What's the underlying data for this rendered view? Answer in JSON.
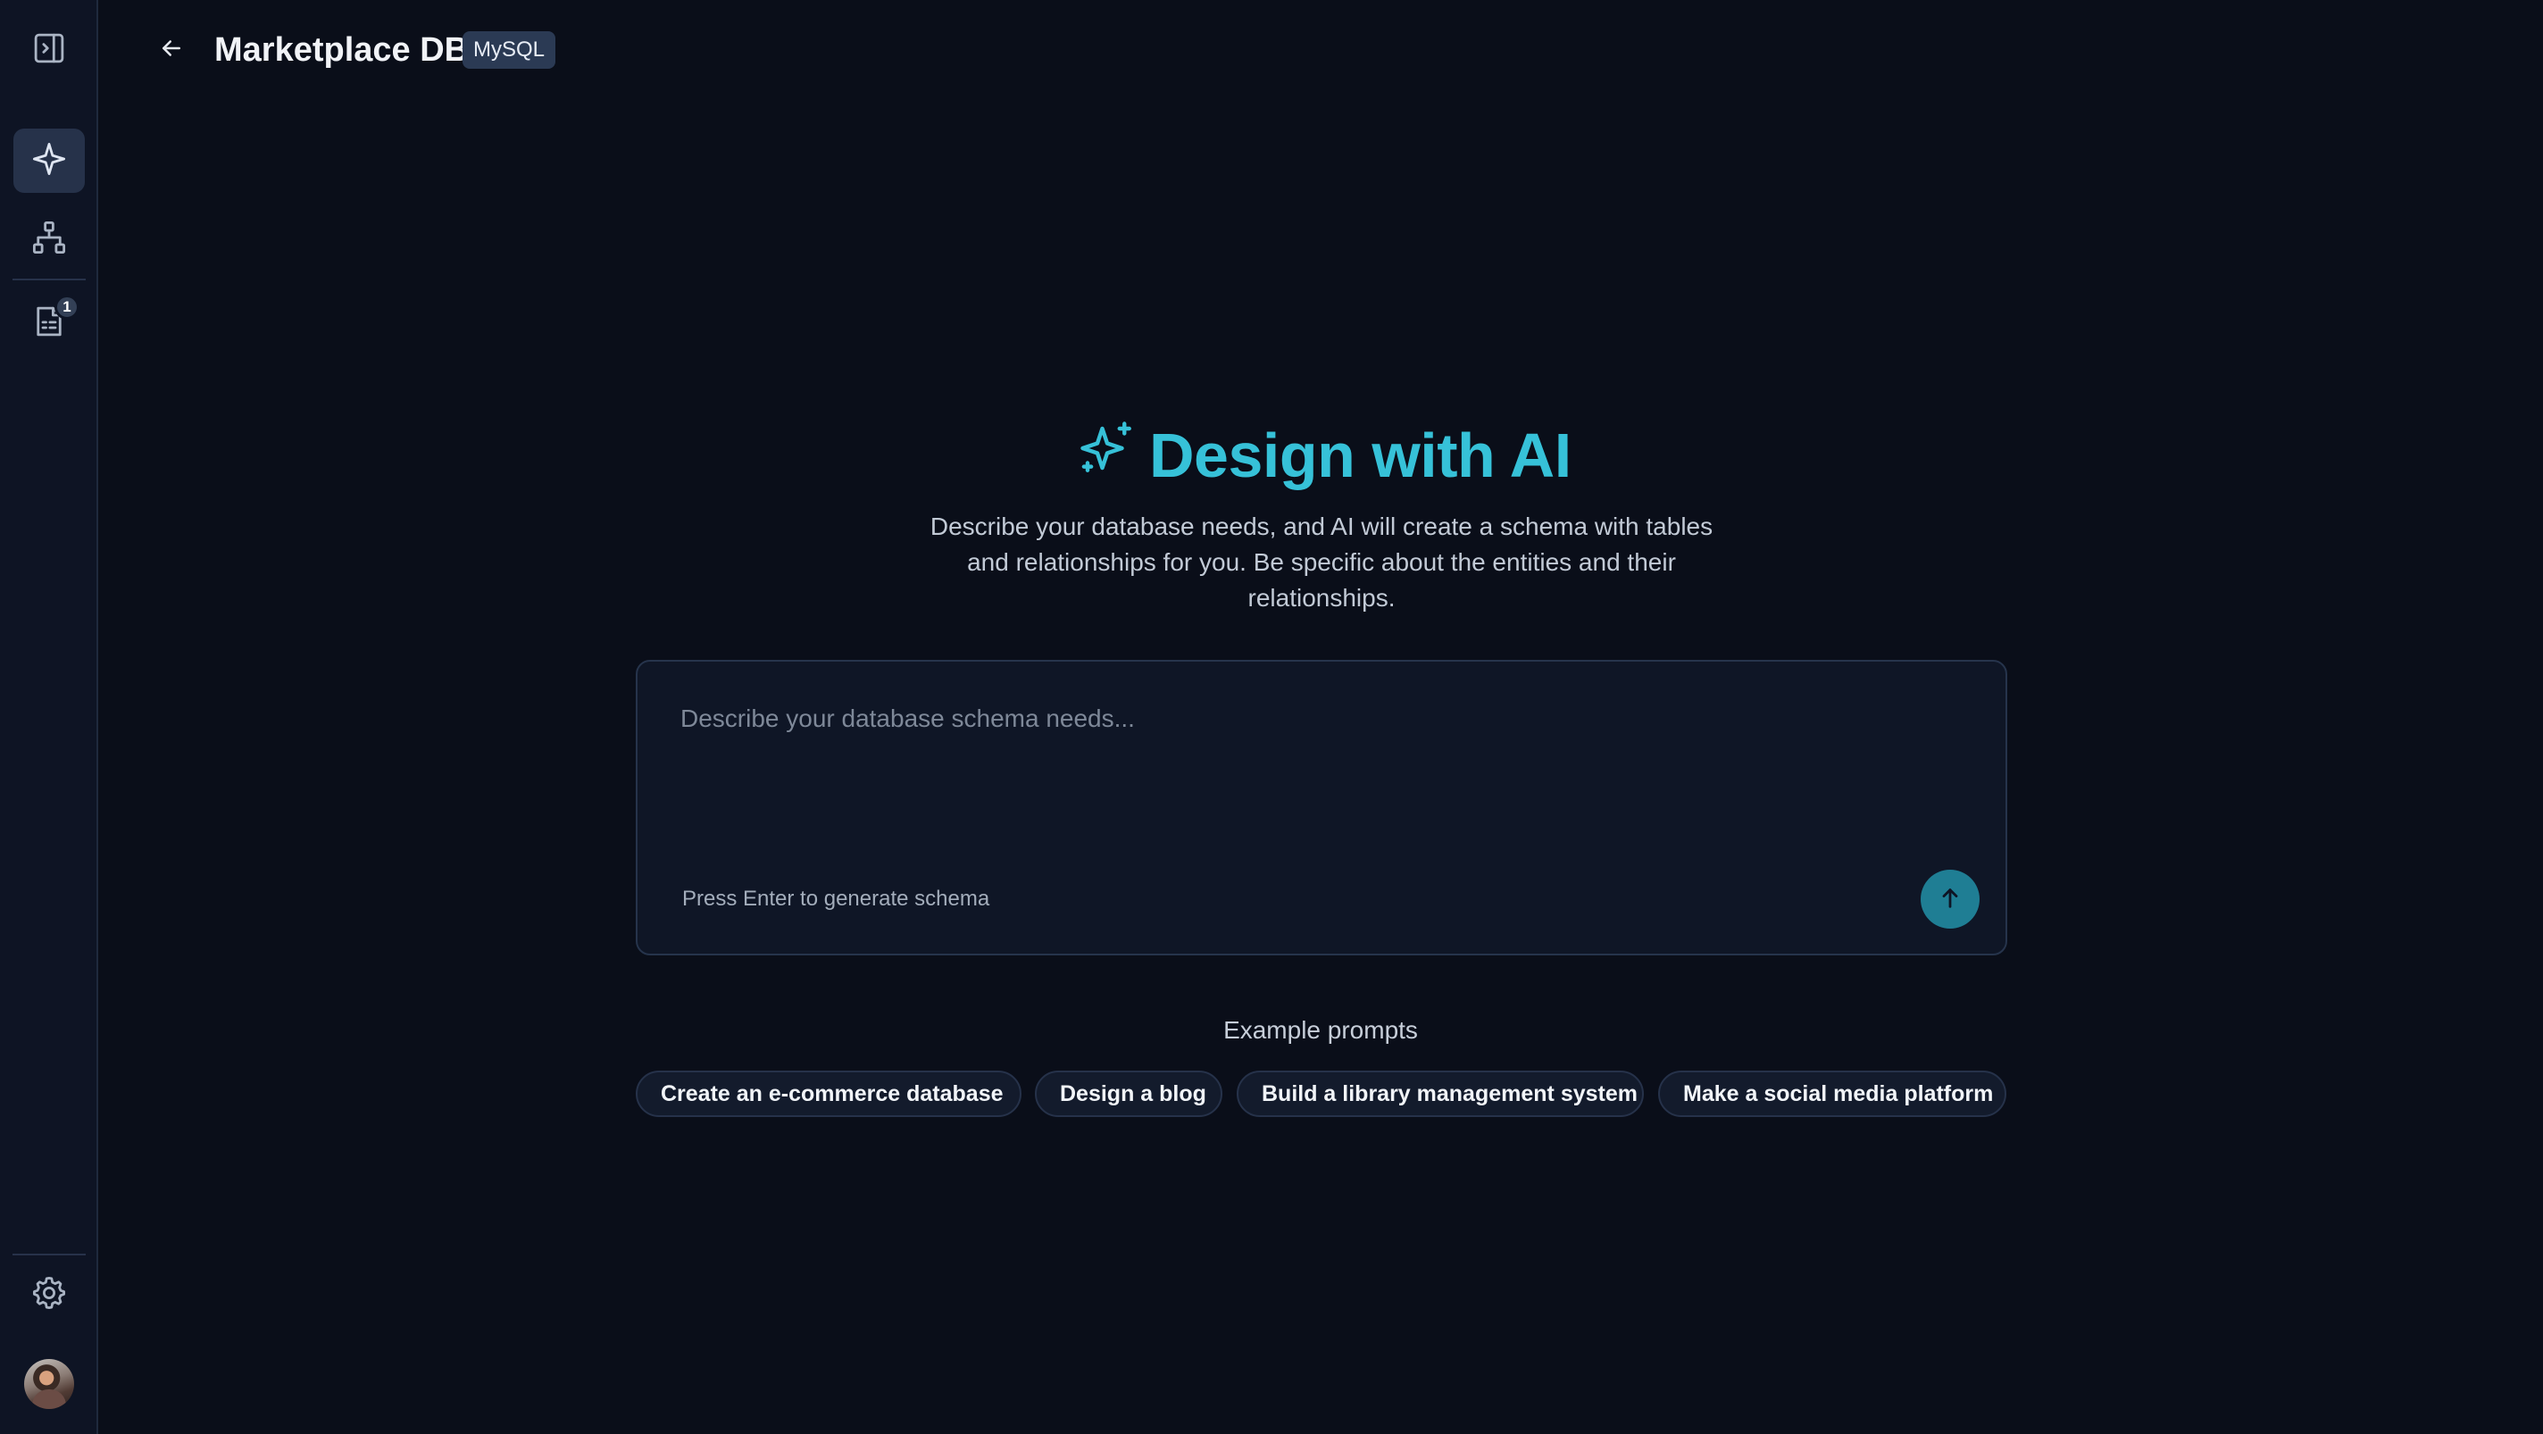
{
  "header": {
    "title": "Marketplace DB",
    "db_type": "MySQL"
  },
  "sidebar": {
    "items": [
      {
        "name": "toggle-sidebar",
        "icon": "panel-toggle-icon"
      },
      {
        "name": "ai-design",
        "icon": "sparkle-icon",
        "active": true
      },
      {
        "name": "diagram",
        "icon": "hierarchy-icon"
      },
      {
        "name": "documents",
        "icon": "document-list-icon",
        "badge": "1"
      }
    ],
    "footer": [
      {
        "name": "settings",
        "icon": "gear-icon"
      },
      {
        "name": "user-avatar",
        "icon": "avatar"
      }
    ]
  },
  "hero": {
    "title": "Design with AI",
    "description": "Describe your database needs, and AI will create a schema with tables and relationships for you. Be specific about the entities and their relationships."
  },
  "prompt": {
    "value": "",
    "placeholder": "Describe your database schema needs...",
    "hint": "Press Enter to generate schema"
  },
  "examples": {
    "title": "Example prompts",
    "items": [
      "Create an e-commerce database",
      "Design a blog",
      "Build a library management system",
      "Make a social media platform"
    ]
  },
  "colors": {
    "background": "#0a0e19",
    "sidebar": "#0e1424",
    "accent": "#36c1d8",
    "send_button": "#1f7e94",
    "badge": "#2b3a54"
  }
}
